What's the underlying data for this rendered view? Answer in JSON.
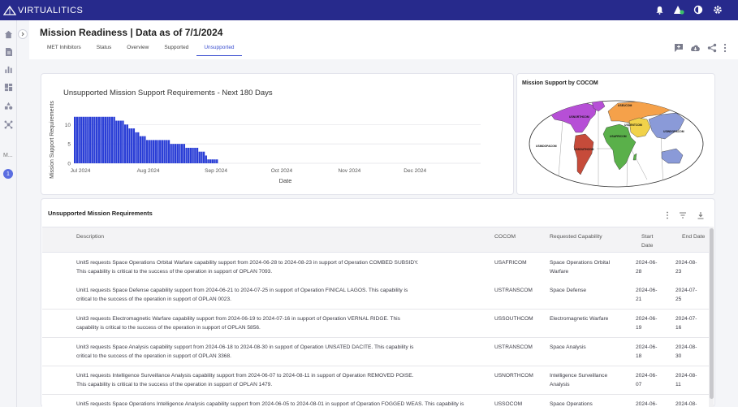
{
  "app": {
    "brand": "VIRTUALITICS"
  },
  "header": {
    "title": "Mission Readiness | Data as of 7/1/2024",
    "tabs": [
      {
        "label": "MET Inhibitors",
        "active": false
      },
      {
        "label": "Status",
        "active": false
      },
      {
        "label": "Overview",
        "active": false
      },
      {
        "label": "Supported",
        "active": false
      },
      {
        "label": "Unsupported",
        "active": true
      }
    ]
  },
  "sidebar": {
    "label_m": "M...",
    "badge": "1"
  },
  "chart_data": {
    "type": "bar",
    "title": "Unsupported Mission Support Requirements - Next 180 Days",
    "xlabel": "Date",
    "ylabel": "Mission Support Requirements",
    "x_start": "2024-06-28",
    "x_end": "2024-12-31",
    "xlim": [
      "2024-06-28",
      "2024-12-31"
    ],
    "ylim": [
      0,
      13
    ],
    "yticks": [
      0,
      5,
      10
    ],
    "xticks": [
      "Jul 2024",
      "Aug 2024",
      "Sep 2024",
      "Oct 2024",
      "Nov 2024",
      "Dec 2024"
    ],
    "xtick_dates": [
      "2024-07-01",
      "2024-08-01",
      "2024-09-01",
      "2024-10-01",
      "2024-11-01",
      "2024-12-01"
    ],
    "grid": true,
    "color": "#2a3ed6",
    "bar_start": "2024-06-28",
    "values": [
      12,
      12,
      12,
      12,
      12,
      12,
      12,
      12,
      12,
      12,
      12,
      12,
      12,
      12,
      12,
      12,
      12,
      12,
      12,
      11,
      11,
      11,
      11,
      10,
      10,
      9,
      9,
      9,
      8,
      8,
      7,
      7,
      7,
      6,
      6,
      6,
      6,
      6,
      6,
      6,
      6,
      6,
      6,
      6,
      5,
      5,
      5,
      5,
      5,
      5,
      5,
      4,
      4,
      4,
      4,
      4,
      4,
      3,
      3,
      3,
      2,
      1,
      1,
      1,
      1,
      1,
      0
    ]
  },
  "map": {
    "title": "Mission Support by COCOM",
    "regions": {
      "northcom": "USNORTHCOM",
      "southcom": "USSOUTHCOM",
      "eucom": "USEUCOM",
      "africom": "USAFRICOM",
      "centcom": "USCENTCOM",
      "indopacom": "USINDOPACOM",
      "indopacom_east": "USINDOPACOM"
    },
    "colors": {
      "northcom": "#b64fd6",
      "southcom": "#c64b3a",
      "eucom": "#f5a14a",
      "africom": "#5ab04a",
      "centcom": "#f1d24a",
      "indopacom": "#8a9ad8",
      "neutral": "#d8d8e0"
    }
  },
  "table": {
    "title": "Unsupported Mission Requirements",
    "columns": {
      "description": "Description",
      "cocom": "COCOM",
      "capability": "Requested Capability",
      "start_date": "Start Date",
      "end_date": "End Date"
    },
    "rows": [
      {
        "desc1": "Unit5 requests Space Operations Orbital Warfare capability support from 2024-06-28 to 2024-08-23 in support of Operation COMBED SUBSIDY.",
        "desc2": "This capability is critical to the success of the operation in support of OPLAN 7093.",
        "cocom": "USAFRICOM",
        "cap1": "Space Operations Orbital",
        "cap2": "Warfare",
        "start1": "2024-06-",
        "start2": "28",
        "end1": "2024-08-",
        "end2": "23"
      },
      {
        "desc1": "Unit1 requests Space Defense capability support from 2024-06-21 to 2024-07-25 in support of Operation FINICAL LAGOS. This capability is",
        "desc2": "critical to the success of the operation in support of OPLAN 0023.",
        "cocom": "USTRANSCOM",
        "cap1": "Space Defense",
        "cap2": "",
        "start1": "2024-06-",
        "start2": "21",
        "end1": "2024-07-",
        "end2": "25"
      },
      {
        "desc1": "Unit3 requests Electromagnetic Warfare capability support from 2024-06-19 to 2024-07-16 in support of Operation VERNAL RIDGE. This",
        "desc2": "capability is critical to the success of the operation in support of OPLAN 5856.",
        "cocom": "USSOUTHCOM",
        "cap1": "Electromagnetic Warfare",
        "cap2": "",
        "start1": "2024-06-",
        "start2": "19",
        "end1": "2024-07-",
        "end2": "16"
      },
      {
        "desc1": "Unit3 requests Space Analysis capability support from 2024-06-18 to 2024-08-30 in support of Operation UNSATED DACITE. This capability is",
        "desc2": "critical to the success of the operation in support of OPLAN 3368.",
        "cocom": "USTRANSCOM",
        "cap1": "Space Analysis",
        "cap2": "",
        "start1": "2024-06-",
        "start2": "18",
        "end1": "2024-08-",
        "end2": "30"
      },
      {
        "desc1": "Unit1 requests Intelligence Surveillance Analysis capability support from 2024-06-07 to 2024-08-11 in support of Operation REMOVED POISE.",
        "desc2": "This capability is critical to the success of the operation in support of OPLAN 1479.",
        "cocom": "USNORTHCOM",
        "cap1": "Intelligence Surveillance",
        "cap2": "Analysis",
        "start1": "2024-06-",
        "start2": "07",
        "end1": "2024-08-",
        "end2": "11"
      },
      {
        "desc1": "Unit5 requests Space Operations Intelligence Analysis capability support from 2024-06-05 to 2024-08-01 in support of Operation FOGGED WEAS. This capability is",
        "desc2": "",
        "cocom": "USSOCOM",
        "cap1": "Space Operations",
        "cap2": "",
        "start1": "2024-06-",
        "start2": "",
        "end1": "2024-08-",
        "end2": ""
      }
    ]
  }
}
